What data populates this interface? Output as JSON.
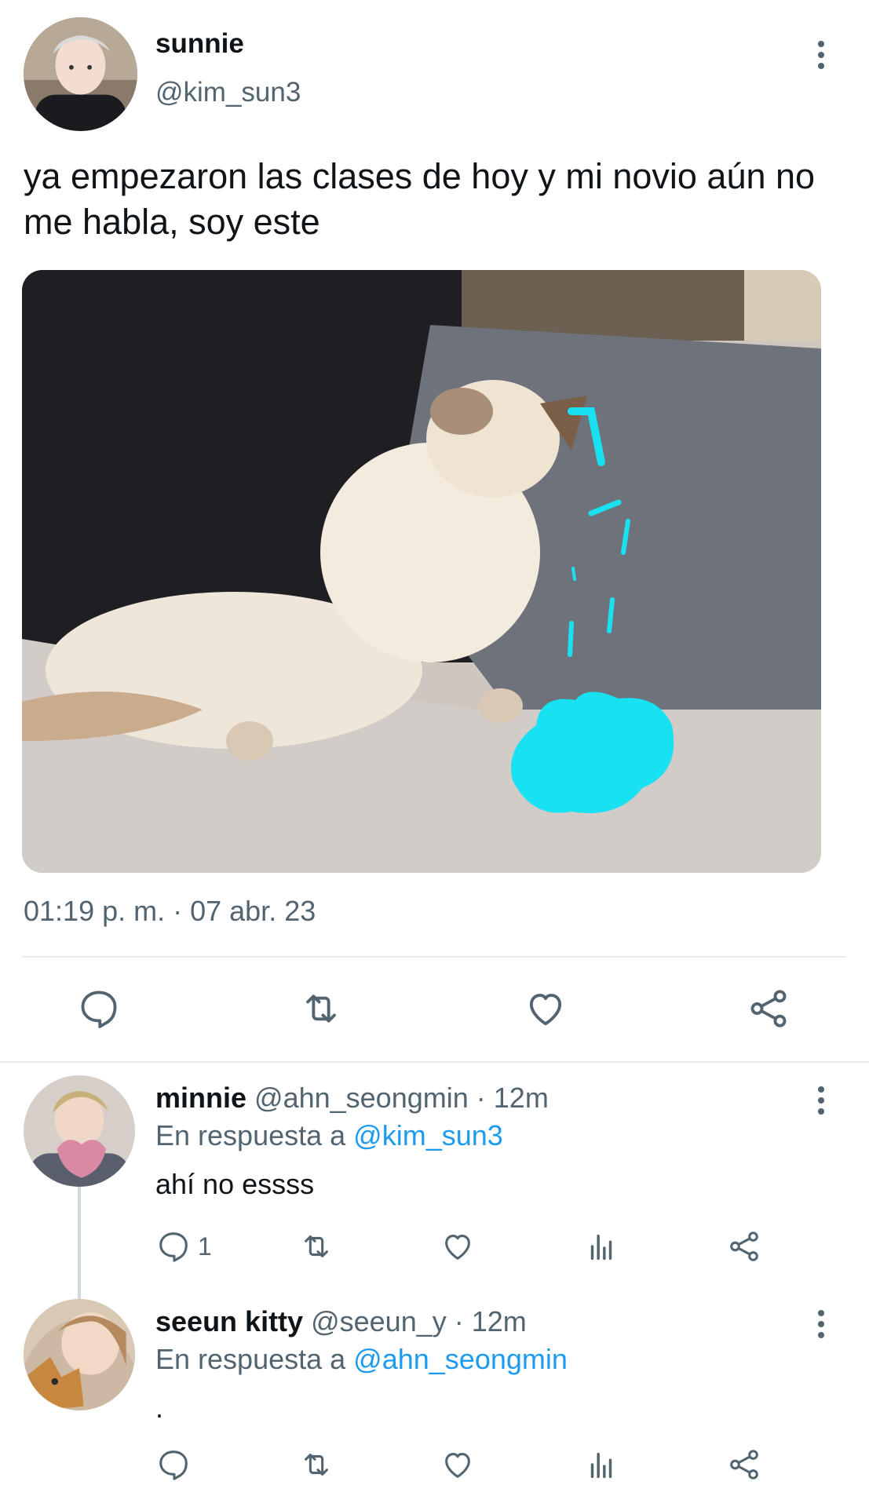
{
  "main_tweet": {
    "display_name": "sunnie",
    "handle": "@kim_sun3",
    "text": "ya empezaron las clases de hoy y mi novio aún no me habla, soy este",
    "timestamp": "01:19 p. m. · 07 abr. 23",
    "media": {
      "description_icon": "crying-cat-image"
    },
    "actions": [
      {
        "name": "reply",
        "icon": "comment-icon"
      },
      {
        "name": "retweet",
        "icon": "retweet-icon"
      },
      {
        "name": "like",
        "icon": "heart-icon"
      },
      {
        "name": "share",
        "icon": "share-icon"
      }
    ]
  },
  "replies": [
    {
      "display_name": "minnie",
      "handle": "@ahn_seongmin",
      "time": "· 12m",
      "reply_to_label": "En respuesta a",
      "reply_to_handle": "@kim_sun3",
      "text": "ahí no essss",
      "reply_count": "1"
    },
    {
      "display_name": "seeun kitty",
      "handle": "@seeun_y",
      "time": "· 12m",
      "reply_to_label": "En respuesta a",
      "reply_to_handle": "@ahn_seongmin",
      "text": ".",
      "reply_count": ""
    }
  ],
  "colors": {
    "text_primary": "#0f1419",
    "text_secondary": "#536471",
    "link": "#1d9bf0",
    "divider": "#e6ecf0",
    "icon": "#536471"
  }
}
